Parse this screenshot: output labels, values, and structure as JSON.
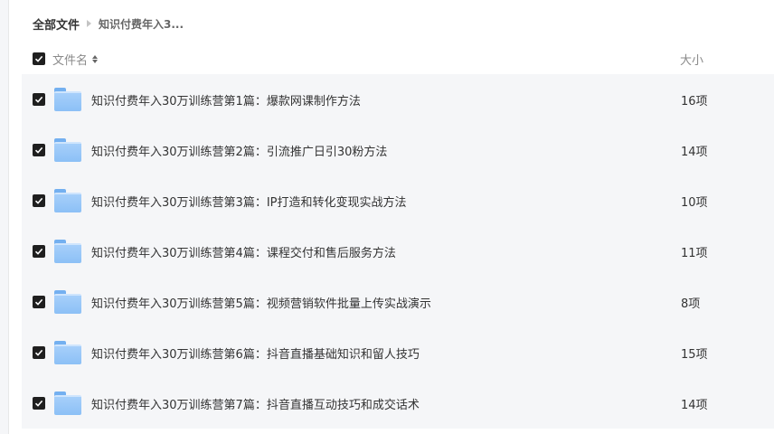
{
  "breadcrumb": {
    "root": "全部文件",
    "current": "知识付费年入3..."
  },
  "header": {
    "name_label": "文件名",
    "size_label": "大小"
  },
  "files": [
    {
      "name": "知识付费年入30万训练营第1篇：爆款网课制作方法",
      "size": "16项"
    },
    {
      "name": "知识付费年入30万训练营第2篇：引流推广日引30粉方法",
      "size": "14项"
    },
    {
      "name": "知识付费年入30万训练营第3篇：IP打造和转化变现实战方法",
      "size": "10项"
    },
    {
      "name": "知识付费年入30万训练营第4篇：课程交付和售后服务方法",
      "size": "11项"
    },
    {
      "name": "知识付费年入30万训练营第5篇：视频营销软件批量上传实战演示",
      "size": "8项"
    },
    {
      "name": "知识付费年入30万训练营第6篇：抖音直播基础知识和留人技巧",
      "size": "15项"
    },
    {
      "name": "知识付费年入30万训练营第7篇：抖音直播互动技巧和成交话术",
      "size": "14项"
    }
  ]
}
